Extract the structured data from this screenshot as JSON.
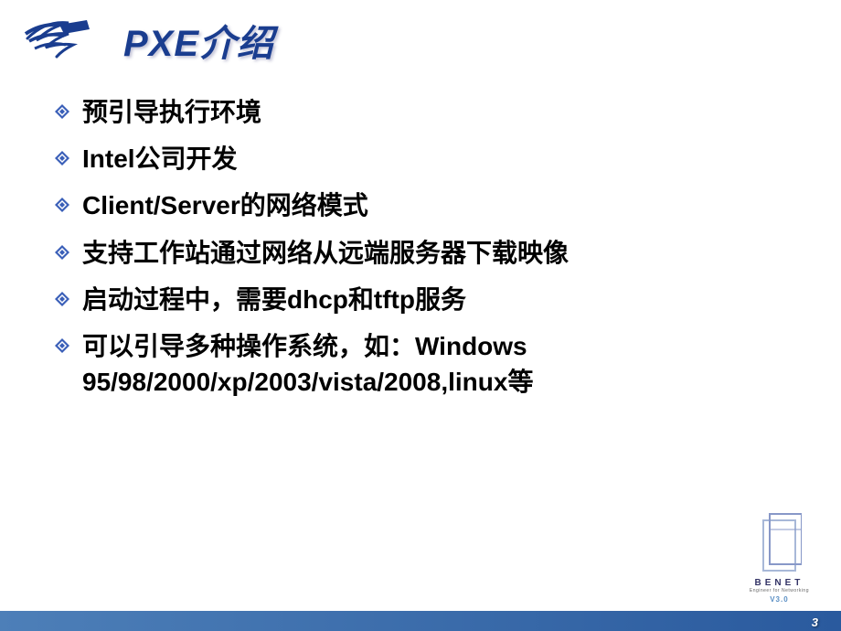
{
  "header": {
    "title": "PXE介绍"
  },
  "bullets": [
    {
      "text": "预引导执行环境"
    },
    {
      "text": "Intel公司开发"
    },
    {
      "text": "Client/Server的网络模式"
    },
    {
      "text": "支持工作站通过网络从远端服务器下载映像"
    },
    {
      "text": "启动过程中，需要dhcp和tftp服务"
    },
    {
      "text": "可以引导多种操作系统，如：Windows 95/98/2000/xp/2003/vista/2008,linux等"
    }
  ],
  "footer": {
    "brand": "BENET",
    "subtitle": "Engineer for Networking",
    "version": "V3.0",
    "page_number": "3"
  }
}
